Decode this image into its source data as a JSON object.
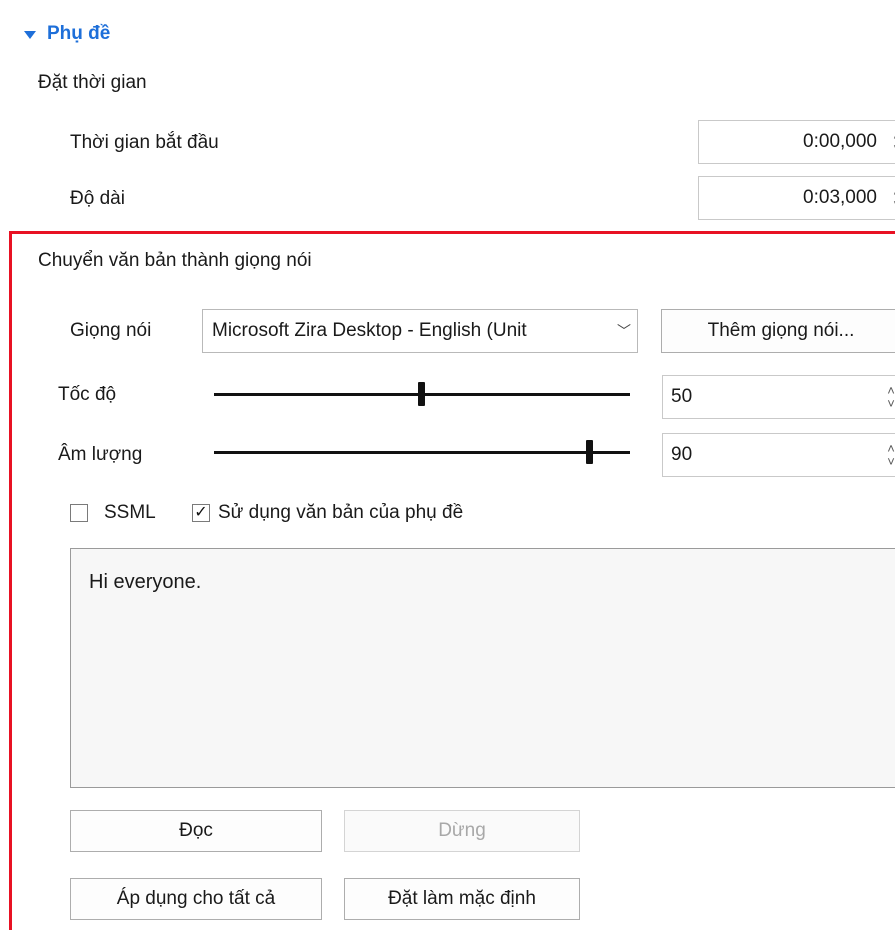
{
  "section": {
    "title": "Phụ đề"
  },
  "timing": {
    "heading": "Đặt thời gian",
    "start_label": "Thời gian bắt đầu",
    "start_value": "0:00,000",
    "duration_label": "Độ dài",
    "duration_value": "0:03,000"
  },
  "tts": {
    "heading": "Chuyển văn bản thành giọng nói",
    "voice_label": "Giọng nói",
    "voice_value": "Microsoft Zira Desktop - English (Unit",
    "add_voice_label": "Thêm giọng nói...",
    "speed_label": "Tốc độ",
    "speed_value": "50",
    "volume_label": "Âm lượng",
    "volume_value": "90",
    "ssml_label": "SSML",
    "ssml_checked": false,
    "use_subtitle_label": "Sử dụng văn bản của phụ đề",
    "use_subtitle_checked": true,
    "text": "Hi everyone.",
    "read_label": "Đọc",
    "stop_label": "Dừng",
    "apply_all_label": "Áp dụng cho tất cả",
    "set_default_label": "Đặt làm mặc định"
  },
  "colors": {
    "accent": "#1e6fd9",
    "highlight_frame": "#e81123"
  },
  "icons": {
    "collapse": "triangle-down-icon",
    "spin": "spin-arrows-icon",
    "dropdown": "chevron-down-icon",
    "check": "checkmark-icon"
  }
}
